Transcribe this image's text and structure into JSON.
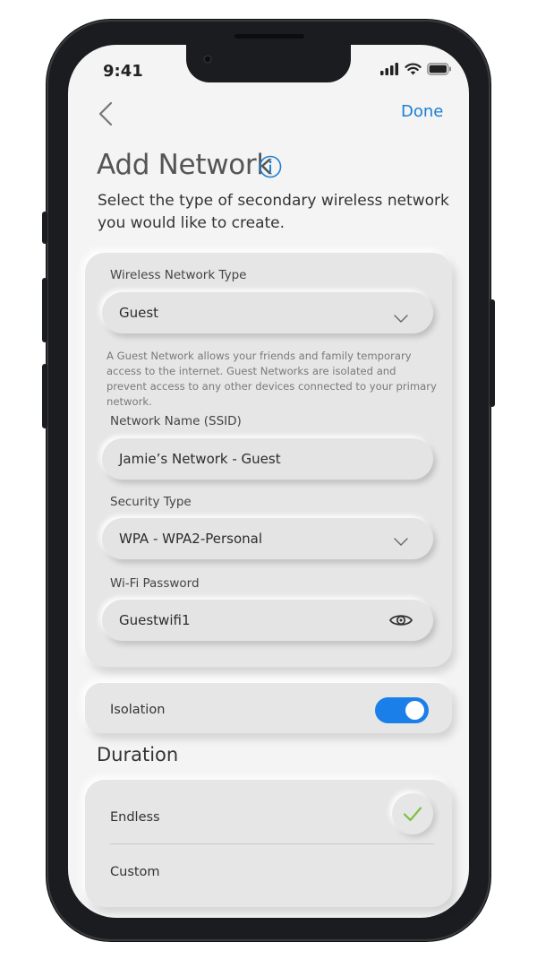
{
  "status_bar": {
    "time": "9:41"
  },
  "nav": {
    "done_label": "Done"
  },
  "header": {
    "title": "Add Network",
    "subtitle": "Select the type of secondary wireless network you would like to create."
  },
  "network_type": {
    "label": "Wireless Network Type",
    "value": "Guest",
    "helper": "A Guest Network allows your friends and family temporary access to the internet. Guest Networks are isolated and prevent access to any other devices connected to your primary network."
  },
  "ssid": {
    "label": "Network Name (SSID)",
    "value": "Jamie’s Network - Guest"
  },
  "security": {
    "label": "Security Type",
    "value": "WPA - WPA2-Personal"
  },
  "password": {
    "label": "Wi-Fi Password",
    "value": "Guestwifi1"
  },
  "isolation": {
    "label": "Isolation",
    "enabled": true
  },
  "duration": {
    "title": "Duration",
    "options": [
      {
        "label": "Endless",
        "selected": true
      },
      {
        "label": "Custom",
        "selected": false
      }
    ]
  },
  "colors": {
    "accent": "#1a7fd6",
    "toggle_on": "#1a7fe8",
    "check": "#7cc043"
  }
}
